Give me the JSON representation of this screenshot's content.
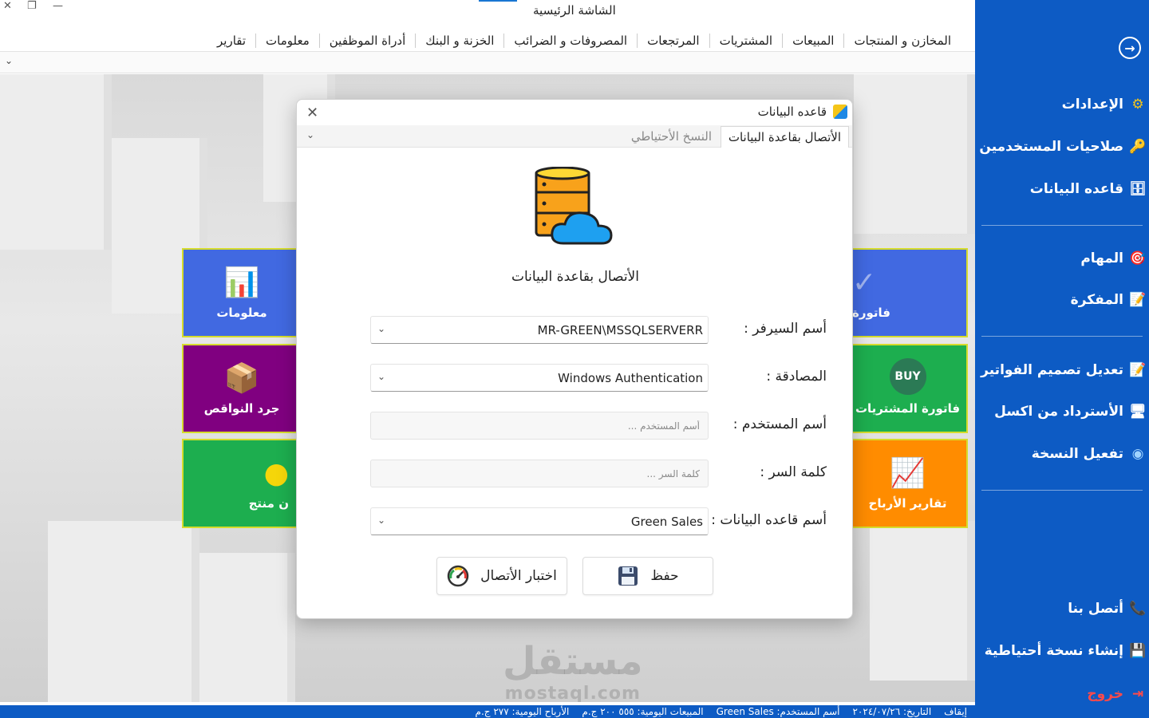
{
  "window": {
    "title": "الشاشة الرئيسية",
    "close_glyph": "✕",
    "restore_glyph": "❐",
    "minimize_glyph": "—"
  },
  "menubar": {
    "items": [
      "المخازن و المنتجات",
      "المبيعات",
      "المشتريات",
      "المرتجعات",
      "المصروفات و الضرائب",
      "الخزنة و البنك",
      "أدراة الموظفين",
      "معلومات",
      "تقارير"
    ]
  },
  "sidebar": {
    "back_icon": "arrow-right-circle-icon",
    "items": [
      {
        "label": "الإعدادات",
        "icon": "gear-icon",
        "glyph": "⚙"
      },
      {
        "label": "صلاحيات المستخدمين",
        "icon": "key-icon",
        "glyph": "🔑"
      },
      {
        "label": "قاعده البيانات",
        "icon": "database-icon",
        "glyph": "🗄"
      },
      {
        "label": "المهام",
        "icon": "target-icon",
        "glyph": "🎯"
      },
      {
        "label": "المفكرة",
        "icon": "notepad-icon",
        "glyph": "📝"
      },
      {
        "label": "تعديل تصميم الفواتير",
        "icon": "edit-document-icon",
        "glyph": "📝"
      },
      {
        "label": "الأسترداد من اكسل",
        "icon": "monitor-icon",
        "glyph": "🖥"
      },
      {
        "label": "تفعيل النسخة",
        "icon": "fingerprint-icon",
        "glyph": "◉"
      },
      {
        "label": "أتصل بنا",
        "icon": "phone-icon",
        "glyph": "📞"
      },
      {
        "label": "إنشاء نسخة أحتياطية",
        "icon": "floppy-disk-icon",
        "glyph": "💾"
      },
      {
        "label": "خروج",
        "icon": "exit-icon",
        "glyph": "⇥"
      }
    ]
  },
  "tiles": {
    "info": {
      "label": "معلومات",
      "glyph": "📊"
    },
    "shortage": {
      "label": "جرد النواقص",
      "glyph": "📦"
    },
    "product": {
      "label": "ن منتج",
      "glyph": "●"
    },
    "sales_invoice": {
      "label": "فاتورة",
      "glyph": "✓"
    },
    "purchase_invoice": {
      "label": "فاتورة المشتريات",
      "glyph": "BUY"
    },
    "profit_reports": {
      "label": "تقارير الأرباح",
      "glyph": "📈"
    }
  },
  "watermark": {
    "brand_ar": "مستقل",
    "brand_en": "mostaql.com"
  },
  "statusbar": {
    "items": [
      "إيقاف",
      "التاريخ: ٢٠٢٤/٠٧/٢٦",
      "أسم المستخدم: Green Sales",
      "المبيعات اليومية: ٥٥٥ ٢٠٠ ج.م",
      "الأرباح اليومية: ٢٧٧ ج.م"
    ]
  },
  "dialog": {
    "title": "قاعده البيانات",
    "close_glyph": "✕",
    "tabs": [
      {
        "label": "الأتصال بقاعدة البيانات",
        "active": true
      },
      {
        "label": "النسخ الأحتياطي",
        "active": false
      }
    ],
    "heading": "الأتصال بقاعدة البيانات",
    "fields": {
      "server": {
        "label": "أسم السيرفر :",
        "value": "MR-GREEN\\MSSQLSERVERR"
      },
      "auth": {
        "label": "المصادقة :",
        "value": "Windows Authentication"
      },
      "username": {
        "label": "أسم المستخدم :",
        "placeholder": "أسم المستخدم ..."
      },
      "password": {
        "label": "كلمة السر :",
        "placeholder": "كلمة السر ..."
      },
      "database": {
        "label": "أسم قاعده البيانات :",
        "value": "Green Sales"
      }
    },
    "buttons": {
      "save": "حفظ",
      "test": "اختبار الأتصال"
    }
  },
  "colors": {
    "sidebar_blue": "#0D5BC4",
    "tile_blue": "#4169E1",
    "tile_purple": "#800080",
    "tile_green": "#1DAE4F",
    "tile_orange": "#FF8C00",
    "tile_border": "#D6DC2C",
    "exit_red": "#FF4A4A"
  }
}
